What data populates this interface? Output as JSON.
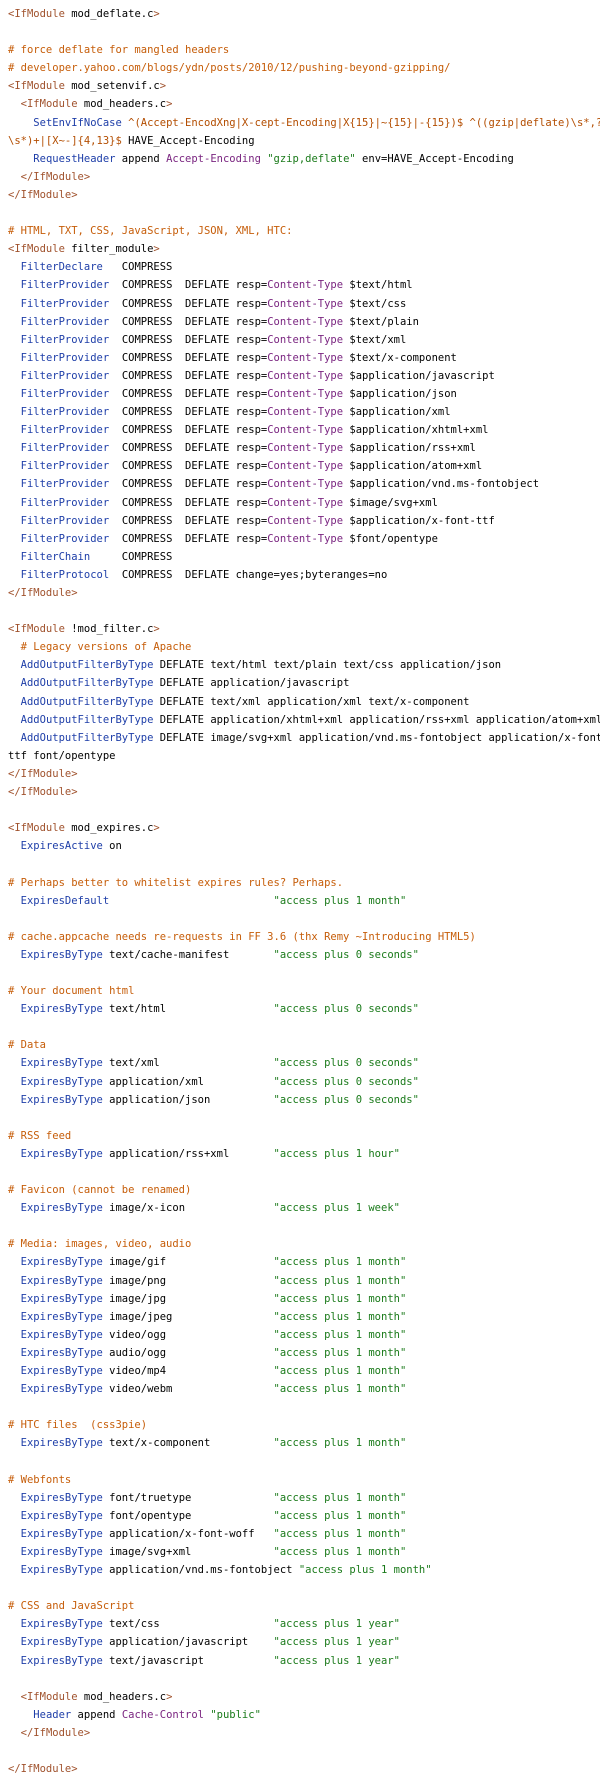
{
  "document": {
    "title": "",
    "colors": {
      "tag": "#a0522d",
      "comment": "#c65d09",
      "directive": "#1e3ea8",
      "string": "#1a7a1a",
      "keyword": "#7a2580",
      "regex": "#b34d00",
      "plain": "#000000",
      "background": "#ffffff"
    },
    "lines": [
      [
        [
          "tag",
          "<IfModule"
        ],
        [
          "p",
          " mod_deflate.c"
        ],
        [
          "tag",
          ">"
        ]
      ],
      [],
      [
        [
          "cm",
          "# force deflate for mangled headers"
        ]
      ],
      [
        [
          "cm",
          "# developer.yahoo.com/blogs/ydn/posts/2010/12/pushing-beyond-gzipping/"
        ]
      ],
      [
        [
          "tag",
          "<IfModule"
        ],
        [
          "p",
          " mod_setenvif.c"
        ],
        [
          "tag",
          ">"
        ]
      ],
      [
        [
          "p",
          "  "
        ],
        [
          "tag",
          "<IfModule"
        ],
        [
          "p",
          " mod_headers.c"
        ],
        [
          "tag",
          ">"
        ]
      ],
      [
        [
          "p",
          "    "
        ],
        [
          "dir",
          "SetEnvIfNoCase"
        ],
        [
          "p",
          " "
        ],
        [
          "re",
          "^(Accept-EncodXng|X-cept-Encoding|X{15}|~{15}|-{15})$"
        ],
        [
          "p",
          " "
        ],
        [
          "re",
          "^((gzip|deflate)\\s*,?"
        ]
      ],
      [
        [
          "re",
          "\\s*)+|[X~-]{4,13}$"
        ],
        [
          "p",
          " HAVE_Accept-Encoding"
        ]
      ],
      [
        [
          "p",
          "    "
        ],
        [
          "dir",
          "RequestHeader"
        ],
        [
          "p",
          " append "
        ],
        [
          "kw",
          "Accept-Encoding"
        ],
        [
          "p",
          " "
        ],
        [
          "str",
          "\"gzip,deflate\""
        ],
        [
          "p",
          " env=HAVE_Accept-Encoding"
        ]
      ],
      [
        [
          "p",
          "  "
        ],
        [
          "tag",
          "</IfModule>"
        ]
      ],
      [
        [
          "tag",
          "</IfModule>"
        ]
      ],
      [],
      [
        [
          "cm",
          "# HTML, TXT, CSS, JavaScript, JSON, XML, HTC:"
        ]
      ],
      [
        [
          "tag",
          "<IfModule"
        ],
        [
          "p",
          " filter_module"
        ],
        [
          "tag",
          ">"
        ]
      ],
      [
        [
          "p",
          "  "
        ],
        [
          "dir",
          "FilterDeclare"
        ],
        [
          "p",
          "   COMPRESS"
        ]
      ],
      [
        [
          "p",
          "  "
        ],
        [
          "dir",
          "FilterProvider"
        ],
        [
          "p",
          "  COMPRESS  DEFLATE resp="
        ],
        [
          "kw",
          "Content-Type"
        ],
        [
          "p",
          " $text/html"
        ]
      ],
      [
        [
          "p",
          "  "
        ],
        [
          "dir",
          "FilterProvider"
        ],
        [
          "p",
          "  COMPRESS  DEFLATE resp="
        ],
        [
          "kw",
          "Content-Type"
        ],
        [
          "p",
          " $text/css"
        ]
      ],
      [
        [
          "p",
          "  "
        ],
        [
          "dir",
          "FilterProvider"
        ],
        [
          "p",
          "  COMPRESS  DEFLATE resp="
        ],
        [
          "kw",
          "Content-Type"
        ],
        [
          "p",
          " $text/plain"
        ]
      ],
      [
        [
          "p",
          "  "
        ],
        [
          "dir",
          "FilterProvider"
        ],
        [
          "p",
          "  COMPRESS  DEFLATE resp="
        ],
        [
          "kw",
          "Content-Type"
        ],
        [
          "p",
          " $text/xml"
        ]
      ],
      [
        [
          "p",
          "  "
        ],
        [
          "dir",
          "FilterProvider"
        ],
        [
          "p",
          "  COMPRESS  DEFLATE resp="
        ],
        [
          "kw",
          "Content-Type"
        ],
        [
          "p",
          " $text/x-component"
        ]
      ],
      [
        [
          "p",
          "  "
        ],
        [
          "dir",
          "FilterProvider"
        ],
        [
          "p",
          "  COMPRESS  DEFLATE resp="
        ],
        [
          "kw",
          "Content-Type"
        ],
        [
          "p",
          " $application/javascript"
        ]
      ],
      [
        [
          "p",
          "  "
        ],
        [
          "dir",
          "FilterProvider"
        ],
        [
          "p",
          "  COMPRESS  DEFLATE resp="
        ],
        [
          "kw",
          "Content-Type"
        ],
        [
          "p",
          " $application/json"
        ]
      ],
      [
        [
          "p",
          "  "
        ],
        [
          "dir",
          "FilterProvider"
        ],
        [
          "p",
          "  COMPRESS  DEFLATE resp="
        ],
        [
          "kw",
          "Content-Type"
        ],
        [
          "p",
          " $application/xml"
        ]
      ],
      [
        [
          "p",
          "  "
        ],
        [
          "dir",
          "FilterProvider"
        ],
        [
          "p",
          "  COMPRESS  DEFLATE resp="
        ],
        [
          "kw",
          "Content-Type"
        ],
        [
          "p",
          " $application/xhtml+xml"
        ]
      ],
      [
        [
          "p",
          "  "
        ],
        [
          "dir",
          "FilterProvider"
        ],
        [
          "p",
          "  COMPRESS  DEFLATE resp="
        ],
        [
          "kw",
          "Content-Type"
        ],
        [
          "p",
          " $application/rss+xml"
        ]
      ],
      [
        [
          "p",
          "  "
        ],
        [
          "dir",
          "FilterProvider"
        ],
        [
          "p",
          "  COMPRESS  DEFLATE resp="
        ],
        [
          "kw",
          "Content-Type"
        ],
        [
          "p",
          " $application/atom+xml"
        ]
      ],
      [
        [
          "p",
          "  "
        ],
        [
          "dir",
          "FilterProvider"
        ],
        [
          "p",
          "  COMPRESS  DEFLATE resp="
        ],
        [
          "kw",
          "Content-Type"
        ],
        [
          "p",
          " $application/vnd.ms-fontobject"
        ]
      ],
      [
        [
          "p",
          "  "
        ],
        [
          "dir",
          "FilterProvider"
        ],
        [
          "p",
          "  COMPRESS  DEFLATE resp="
        ],
        [
          "kw",
          "Content-Type"
        ],
        [
          "p",
          " $image/svg+xml"
        ]
      ],
      [
        [
          "p",
          "  "
        ],
        [
          "dir",
          "FilterProvider"
        ],
        [
          "p",
          "  COMPRESS  DEFLATE resp="
        ],
        [
          "kw",
          "Content-Type"
        ],
        [
          "p",
          " $application/x-font-ttf"
        ]
      ],
      [
        [
          "p",
          "  "
        ],
        [
          "dir",
          "FilterProvider"
        ],
        [
          "p",
          "  COMPRESS  DEFLATE resp="
        ],
        [
          "kw",
          "Content-Type"
        ],
        [
          "p",
          " $font/opentype"
        ]
      ],
      [
        [
          "p",
          "  "
        ],
        [
          "dir",
          "FilterChain"
        ],
        [
          "p",
          "     COMPRESS"
        ]
      ],
      [
        [
          "p",
          "  "
        ],
        [
          "dir",
          "FilterProtocol"
        ],
        [
          "p",
          "  COMPRESS  DEFLATE change=yes;byteranges=no"
        ]
      ],
      [
        [
          "tag",
          "</IfModule>"
        ]
      ],
      [],
      [
        [
          "tag",
          "<IfModule"
        ],
        [
          "p",
          " !mod_filter.c"
        ],
        [
          "tag",
          ">"
        ]
      ],
      [
        [
          "p",
          "  "
        ],
        [
          "cm",
          "# Legacy versions of Apache"
        ]
      ],
      [
        [
          "p",
          "  "
        ],
        [
          "dir",
          "AddOutputFilterByType"
        ],
        [
          "p",
          " DEFLATE text/html text/plain text/css application/json"
        ]
      ],
      [
        [
          "p",
          "  "
        ],
        [
          "dir",
          "AddOutputFilterByType"
        ],
        [
          "p",
          " DEFLATE application/javascript"
        ]
      ],
      [
        [
          "p",
          "  "
        ],
        [
          "dir",
          "AddOutputFilterByType"
        ],
        [
          "p",
          " DEFLATE text/xml application/xml text/x-component"
        ]
      ],
      [
        [
          "p",
          "  "
        ],
        [
          "dir",
          "AddOutputFilterByType"
        ],
        [
          "p",
          " DEFLATE application/xhtml+xml application/rss+xml application/atom+xml"
        ]
      ],
      [
        [
          "p",
          "  "
        ],
        [
          "dir",
          "AddOutputFilterByType"
        ],
        [
          "p",
          " DEFLATE image/svg+xml application/vnd.ms-fontobject application/x-font-"
        ]
      ],
      [
        [
          "p",
          "ttf font/opentype"
        ]
      ],
      [
        [
          "tag",
          "</IfModule>"
        ]
      ],
      [
        [
          "tag",
          "</IfModule>"
        ]
      ],
      [],
      [
        [
          "tag",
          "<IfModule"
        ],
        [
          "p",
          " mod_expires.c"
        ],
        [
          "tag",
          ">"
        ]
      ],
      [
        [
          "p",
          "  "
        ],
        [
          "dir",
          "ExpiresActive"
        ],
        [
          "p",
          " on"
        ]
      ],
      [],
      [
        [
          "cm",
          "# Perhaps better to whitelist expires rules? Perhaps."
        ]
      ],
      [
        [
          "p",
          "  "
        ],
        [
          "dir",
          "ExpiresDefault"
        ],
        [
          "p",
          "                          "
        ],
        [
          "str",
          "\"access plus 1 month\""
        ]
      ],
      [],
      [
        [
          "cm",
          "# cache.appcache needs re-requests in FF 3.6 (thx Remy ~Introducing HTML5)"
        ]
      ],
      [
        [
          "p",
          "  "
        ],
        [
          "dir",
          "ExpiresByType"
        ],
        [
          "p",
          " text/cache-manifest       "
        ],
        [
          "str",
          "\"access plus 0 seconds\""
        ]
      ],
      [],
      [
        [
          "cm",
          "# Your document html"
        ]
      ],
      [
        [
          "p",
          "  "
        ],
        [
          "dir",
          "ExpiresByType"
        ],
        [
          "p",
          " text/html                 "
        ],
        [
          "str",
          "\"access plus 0 seconds\""
        ]
      ],
      [],
      [
        [
          "cm",
          "# Data"
        ]
      ],
      [
        [
          "p",
          "  "
        ],
        [
          "dir",
          "ExpiresByType"
        ],
        [
          "p",
          " text/xml                  "
        ],
        [
          "str",
          "\"access plus 0 seconds\""
        ]
      ],
      [
        [
          "p",
          "  "
        ],
        [
          "dir",
          "ExpiresByType"
        ],
        [
          "p",
          " application/xml           "
        ],
        [
          "str",
          "\"access plus 0 seconds\""
        ]
      ],
      [
        [
          "p",
          "  "
        ],
        [
          "dir",
          "ExpiresByType"
        ],
        [
          "p",
          " application/json          "
        ],
        [
          "str",
          "\"access plus 0 seconds\""
        ]
      ],
      [],
      [
        [
          "cm",
          "# RSS feed"
        ]
      ],
      [
        [
          "p",
          "  "
        ],
        [
          "dir",
          "ExpiresByType"
        ],
        [
          "p",
          " application/rss+xml       "
        ],
        [
          "str",
          "\"access plus 1 hour\""
        ]
      ],
      [],
      [
        [
          "cm",
          "# Favicon (cannot be renamed)"
        ]
      ],
      [
        [
          "p",
          "  "
        ],
        [
          "dir",
          "ExpiresByType"
        ],
        [
          "p",
          " image/x-icon              "
        ],
        [
          "str",
          "\"access plus 1 week\""
        ]
      ],
      [],
      [
        [
          "cm",
          "# Media: images, video, audio"
        ]
      ],
      [
        [
          "p",
          "  "
        ],
        [
          "dir",
          "ExpiresByType"
        ],
        [
          "p",
          " image/gif                 "
        ],
        [
          "str",
          "\"access plus 1 month\""
        ]
      ],
      [
        [
          "p",
          "  "
        ],
        [
          "dir",
          "ExpiresByType"
        ],
        [
          "p",
          " image/png                 "
        ],
        [
          "str",
          "\"access plus 1 month\""
        ]
      ],
      [
        [
          "p",
          "  "
        ],
        [
          "dir",
          "ExpiresByType"
        ],
        [
          "p",
          " image/jpg                 "
        ],
        [
          "str",
          "\"access plus 1 month\""
        ]
      ],
      [
        [
          "p",
          "  "
        ],
        [
          "dir",
          "ExpiresByType"
        ],
        [
          "p",
          " image/jpeg                "
        ],
        [
          "str",
          "\"access plus 1 month\""
        ]
      ],
      [
        [
          "p",
          "  "
        ],
        [
          "dir",
          "ExpiresByType"
        ],
        [
          "p",
          " video/ogg                 "
        ],
        [
          "str",
          "\"access plus 1 month\""
        ]
      ],
      [
        [
          "p",
          "  "
        ],
        [
          "dir",
          "ExpiresByType"
        ],
        [
          "p",
          " audio/ogg                 "
        ],
        [
          "str",
          "\"access plus 1 month\""
        ]
      ],
      [
        [
          "p",
          "  "
        ],
        [
          "dir",
          "ExpiresByType"
        ],
        [
          "p",
          " video/mp4                 "
        ],
        [
          "str",
          "\"access plus 1 month\""
        ]
      ],
      [
        [
          "p",
          "  "
        ],
        [
          "dir",
          "ExpiresByType"
        ],
        [
          "p",
          " video/webm                "
        ],
        [
          "str",
          "\"access plus 1 month\""
        ]
      ],
      [],
      [
        [
          "cm",
          "# HTC files  (css3pie)"
        ]
      ],
      [
        [
          "p",
          "  "
        ],
        [
          "dir",
          "ExpiresByType"
        ],
        [
          "p",
          " text/x-component          "
        ],
        [
          "str",
          "\"access plus 1 month\""
        ]
      ],
      [],
      [
        [
          "cm",
          "# Webfonts"
        ]
      ],
      [
        [
          "p",
          "  "
        ],
        [
          "dir",
          "ExpiresByType"
        ],
        [
          "p",
          " font/truetype             "
        ],
        [
          "str",
          "\"access plus 1 month\""
        ]
      ],
      [
        [
          "p",
          "  "
        ],
        [
          "dir",
          "ExpiresByType"
        ],
        [
          "p",
          " font/opentype             "
        ],
        [
          "str",
          "\"access plus 1 month\""
        ]
      ],
      [
        [
          "p",
          "  "
        ],
        [
          "dir",
          "ExpiresByType"
        ],
        [
          "p",
          " application/x-font-woff   "
        ],
        [
          "str",
          "\"access plus 1 month\""
        ]
      ],
      [
        [
          "p",
          "  "
        ],
        [
          "dir",
          "ExpiresByType"
        ],
        [
          "p",
          " image/svg+xml             "
        ],
        [
          "str",
          "\"access plus 1 month\""
        ]
      ],
      [
        [
          "p",
          "  "
        ],
        [
          "dir",
          "ExpiresByType"
        ],
        [
          "p",
          " application/vnd.ms-fontobject "
        ],
        [
          "str",
          "\"access plus 1 month\""
        ]
      ],
      [],
      [
        [
          "cm",
          "# CSS and JavaScript"
        ]
      ],
      [
        [
          "p",
          "  "
        ],
        [
          "dir",
          "ExpiresByType"
        ],
        [
          "p",
          " text/css                  "
        ],
        [
          "str",
          "\"access plus 1 year\""
        ]
      ],
      [
        [
          "p",
          "  "
        ],
        [
          "dir",
          "ExpiresByType"
        ],
        [
          "p",
          " application/javascript    "
        ],
        [
          "str",
          "\"access plus 1 year\""
        ]
      ],
      [
        [
          "p",
          "  "
        ],
        [
          "dir",
          "ExpiresByType"
        ],
        [
          "p",
          " text/javascript           "
        ],
        [
          "str",
          "\"access plus 1 year\""
        ]
      ],
      [],
      [
        [
          "p",
          "  "
        ],
        [
          "tag",
          "<IfModule"
        ],
        [
          "p",
          " mod_headers.c"
        ],
        [
          "tag",
          ">"
        ]
      ],
      [
        [
          "p",
          "    "
        ],
        [
          "dir",
          "Header"
        ],
        [
          "p",
          " append "
        ],
        [
          "kw",
          "Cache-Control"
        ],
        [
          "p",
          " "
        ],
        [
          "str",
          "\"public\""
        ]
      ],
      [
        [
          "p",
          "  "
        ],
        [
          "tag",
          "</IfModule>"
        ]
      ],
      [],
      [
        [
          "tag",
          "</IfModule>"
        ]
      ]
    ]
  }
}
